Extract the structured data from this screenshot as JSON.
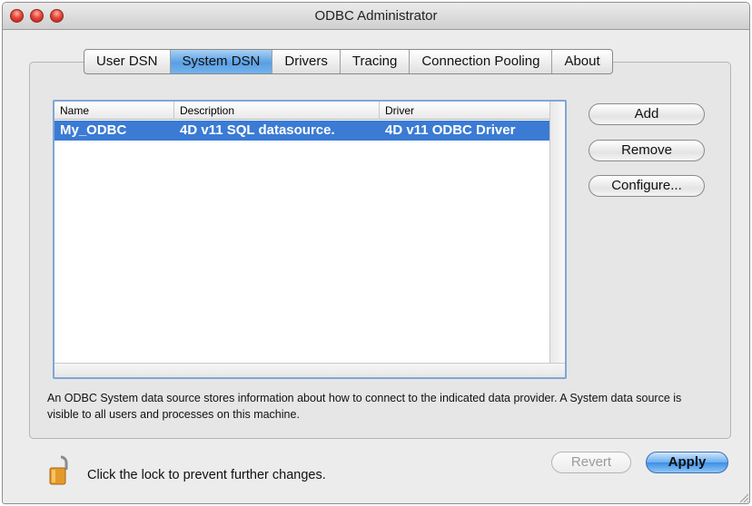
{
  "window": {
    "title": "ODBC Administrator"
  },
  "tabs": [
    {
      "label": "User DSN",
      "selected": false
    },
    {
      "label": "System DSN",
      "selected": true
    },
    {
      "label": "Drivers",
      "selected": false
    },
    {
      "label": "Tracing",
      "selected": false
    },
    {
      "label": "Connection Pooling",
      "selected": false
    },
    {
      "label": "About",
      "selected": false
    }
  ],
  "table": {
    "columns": [
      "Name",
      "Description",
      "Driver"
    ],
    "rows": [
      {
        "name": "My_ODBC",
        "description": "4D v11 SQL datasource.",
        "driver": "4D v11 ODBC Driver",
        "selected": true
      }
    ]
  },
  "buttons": {
    "add": "Add",
    "remove": "Remove",
    "configure": "Configure...",
    "revert": "Revert",
    "apply": "Apply"
  },
  "description": "An ODBC System data source stores information about how to connect to the indicated data provider. A System data source is visible to all users and processes on this machine.",
  "footer": {
    "lock_text": "Click the lock to prevent further changes."
  },
  "icons": {
    "close": "close-icon",
    "minimize": "minimize-icon",
    "zoom": "zoom-icon",
    "lock": "lock-icon",
    "resize": "resize-grip-icon"
  },
  "colors": {
    "selection": "#3b7bd4",
    "tab_selected": "#6aaef0",
    "traffic_red": "#e8463a"
  }
}
